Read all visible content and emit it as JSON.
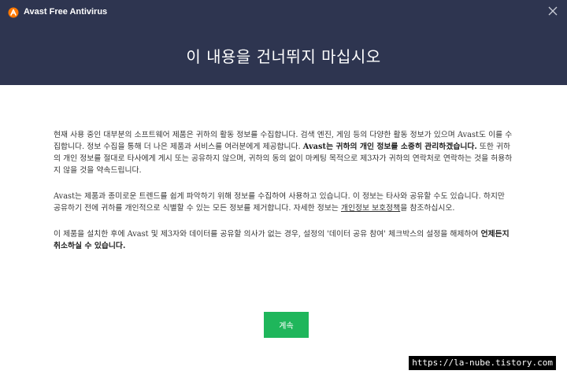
{
  "window": {
    "title": "Avast Free Antivirus",
    "logo_icon": "avast-logo-icon",
    "close_icon": "close-icon"
  },
  "header": {
    "headline": "이 내용을 건너뛰지 마십시오",
    "background": "#2e3550"
  },
  "body": {
    "p1_a": "현재 사용 중인 대부분의 소프트웨어 제품은 귀하의 활동 정보를 수집합니다. 검색 엔진, 게임 등의 다양한 활동 정보가 있으며 Avast도 이를 수집합니다. 정보 수집을 통해 더 나은 제품과 서비스를 여러분에게 제공합니다. ",
    "p1_b": "Avast는 귀하의 개인 정보를 소중히 관리하겠습니다.",
    "p1_c": " 또한 귀하의 개인 정보를 절대로 타사에게 게시 또는 공유하지 않으며, 귀하의 동의 없이 마케팅 목적으로 제3자가 귀하의 연락처로 연락하는 것을 허용하지 않을 것을 약속드립니다.",
    "p2_a": "Avast는 제품과 종미로운 트렌드를 쉽게 파악하기 위해 정보를 수집하여 사용하고 있습니다. 이 정보는 타사와 공유할 수도 있습니다. 하지만 공유하기 전에 귀하를 개인적으로 식별할 수 있는 모든 정보를 제거합니다. 자세한 정보는 ",
    "p2_link": "개인정보 보호정책",
    "p2_c": "을 참조하십시오.",
    "p3_a": "이 제품을 설치한 후에 Avast 및 제3자와 데이터를 공유할 의사가 없는 경우, 설정의 '데이터 공유 참여' 체크박스의 설정을 해제하여 ",
    "p3_b": "언제든지 취소하실 수 있습니다."
  },
  "actions": {
    "continue_label": "계속",
    "continue_color": "#1fb65b"
  },
  "watermark": "https://la-nube.tistory.com"
}
